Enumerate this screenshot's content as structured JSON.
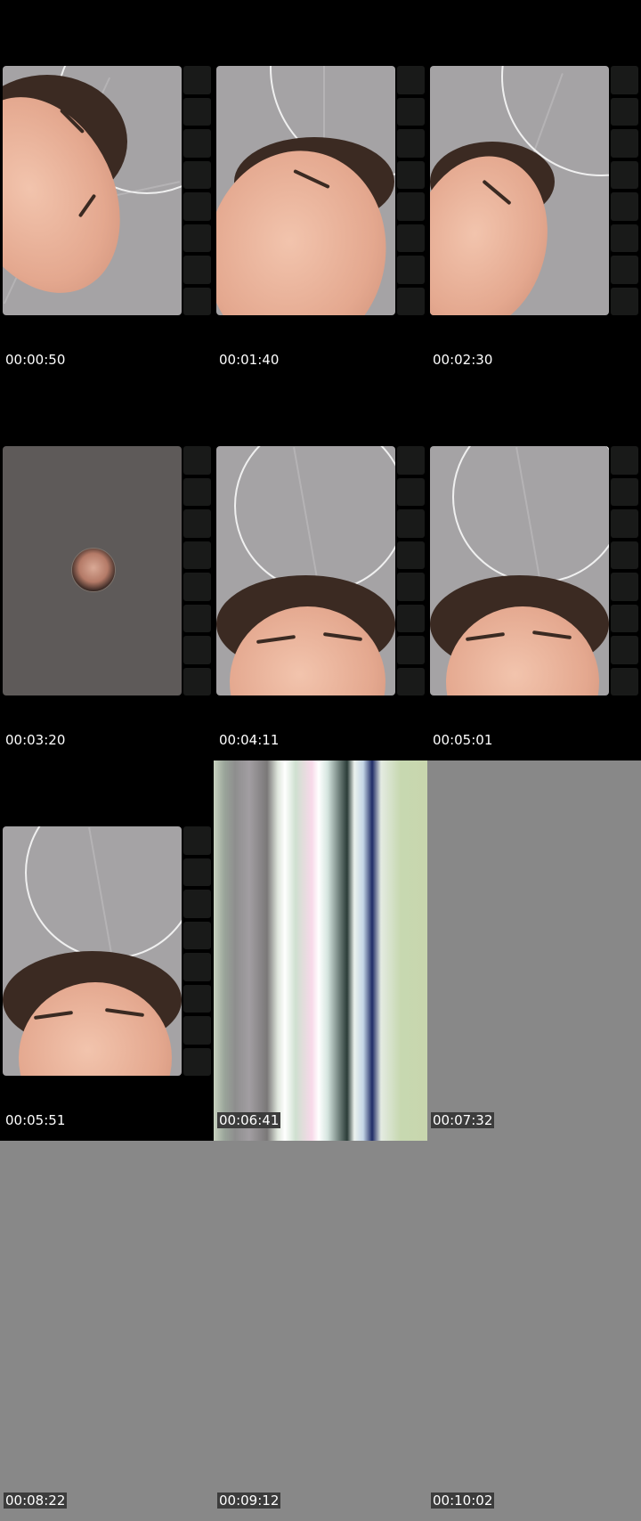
{
  "frames": [
    {
      "time": "00:00:50",
      "kind": "face-tilted"
    },
    {
      "time": "00:01:40",
      "kind": "face-smile"
    },
    {
      "time": "00:02:30",
      "kind": "face-closed-eyes"
    },
    {
      "time": "00:03:20",
      "kind": "avatar-screen"
    },
    {
      "time": "00:04:11",
      "kind": "forehead"
    },
    {
      "time": "00:05:01",
      "kind": "forehead"
    },
    {
      "time": "00:05:51",
      "kind": "forehead"
    },
    {
      "time": "00:06:41",
      "kind": "glitch"
    },
    {
      "time": "00:07:32",
      "kind": "gray"
    },
    {
      "time": "00:08:22",
      "kind": "gray"
    },
    {
      "time": "00:09:12",
      "kind": "gray"
    },
    {
      "time": "00:10:02",
      "kind": "gray"
    }
  ],
  "colors": {
    "background": "#000000",
    "gray_fill": "#888888",
    "timestamp_text": "#ffffff"
  }
}
